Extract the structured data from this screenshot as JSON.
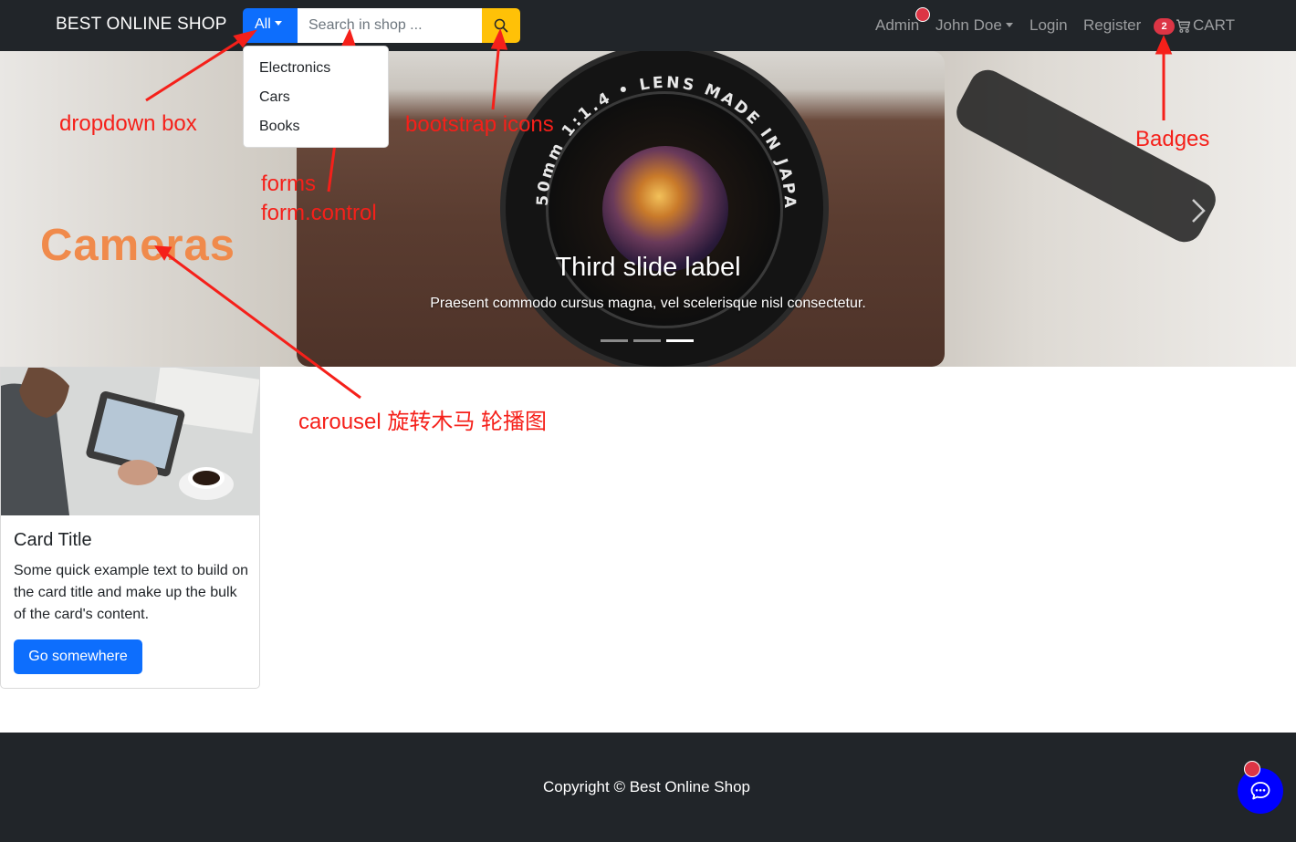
{
  "navbar": {
    "brand": "BEST ONLINE SHOP",
    "category_button": "All",
    "search_placeholder": "Search in shop ...",
    "links": {
      "admin": "Admin",
      "user": "John Doe",
      "login": "Login",
      "register": "Register"
    },
    "cart": {
      "badge_count": "2",
      "label": "CART"
    }
  },
  "dropdown": {
    "items": [
      "Electronics",
      "Cars",
      "Books"
    ]
  },
  "carousel": {
    "image_title": "Cameras",
    "caption_title": "Third slide label",
    "caption_text": "Praesent commodo cursus magna, vel scelerisque nisl consectetur.",
    "slide_count": 3,
    "active_slide": 3
  },
  "card": {
    "title": "Card Title",
    "text": "Some quick example text to build on the card title and make up the bulk of the card's content.",
    "button": "Go somewhere"
  },
  "footer": {
    "copyright": "Copyright © Best Online Shop"
  },
  "annotations": {
    "dropdown": "dropdown box",
    "forms": "forms",
    "form_control": "form.control",
    "icons": "bootstrap icons",
    "badges": "Badges",
    "carousel": "carousel 旋转木马 轮播图"
  },
  "colors": {
    "navbar_bg": "#212529",
    "primary": "#0d6efd",
    "warning": "#ffc107",
    "danger": "#dc3545",
    "annotation": "#f5201a",
    "chat_button": "#0000ff"
  },
  "icons": [
    "search-icon",
    "cart-icon",
    "chat-icon",
    "chevron-right-icon"
  ]
}
